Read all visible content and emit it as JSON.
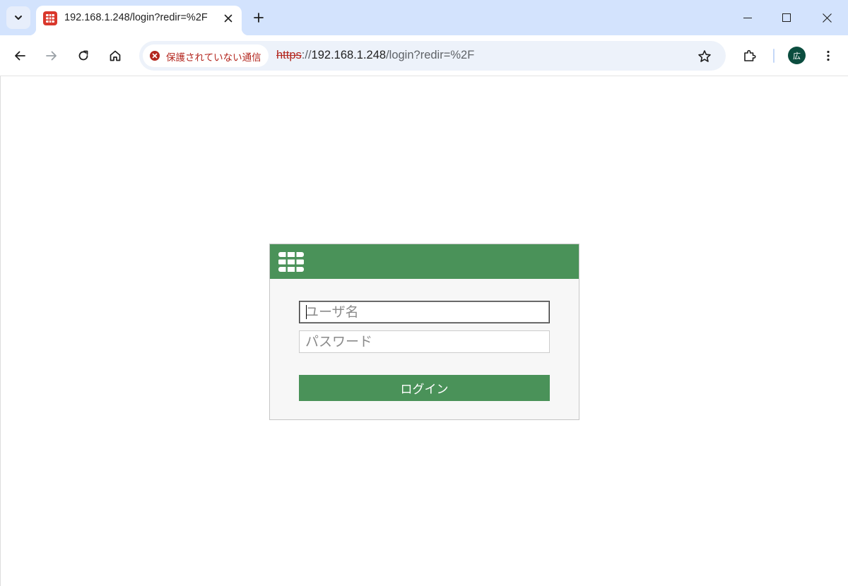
{
  "browser": {
    "tab": {
      "title": "192.168.1.248/login?redir=%2F"
    },
    "omnibox": {
      "security_label": "保護されていない通信",
      "url_scheme": "https",
      "url_separator": "://",
      "url_host": "192.168.1.248",
      "url_path": "/login?redir=%2F"
    },
    "profile_initial": "広",
    "icons": {
      "tab_search": "chevron-down-icon",
      "favicon": "fortinet-icon",
      "tab_close": "close-icon",
      "new_tab": "plus-icon",
      "minimize": "minimize-icon",
      "maximize": "maximize-icon",
      "close_window": "close-icon",
      "back": "arrow-left-icon",
      "forward": "arrow-right-icon",
      "reload": "reload-icon",
      "home": "home-icon",
      "security_warning": "error-circle-icon",
      "bookmark": "star-icon",
      "extensions": "puzzle-icon",
      "menu": "more-vertical-icon"
    },
    "colors": {
      "tabstrip": "#d3e3fd",
      "warning": "#b3261e",
      "avatar": "#0b4d3f"
    }
  },
  "login": {
    "username_placeholder": "ユーザ名",
    "password_placeholder": "パスワード",
    "button_label": "ログイン",
    "colors": {
      "header": "#4a9259",
      "button": "#4a9259",
      "panel": "#f7f7f7"
    }
  }
}
